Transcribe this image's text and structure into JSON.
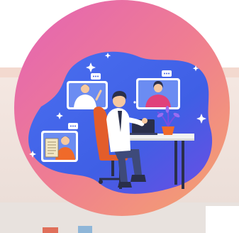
{
  "scene": {
    "subject": "video-conference-illustration",
    "colors": {
      "ring_gradient_start": "#e86aa8",
      "ring_gradient_mid": "#ef7f8f",
      "ring_gradient_end": "#f3a86f",
      "blob_blue": "#3f63e6",
      "blob_purple": "#7a4de3",
      "shirt_orange": "#f06a2a",
      "shirt_pink": "#e0417a",
      "skin": "#f6c89f",
      "hair": "#2a2f4a",
      "desk": "#f2f2f2",
      "chair": "#e35d2b",
      "pants": "#3e4a7a"
    },
    "icons": [
      "chat-bubble-icon",
      "sparkle-icon",
      "plant-icon",
      "laptop-icon",
      "document-icon"
    ]
  }
}
